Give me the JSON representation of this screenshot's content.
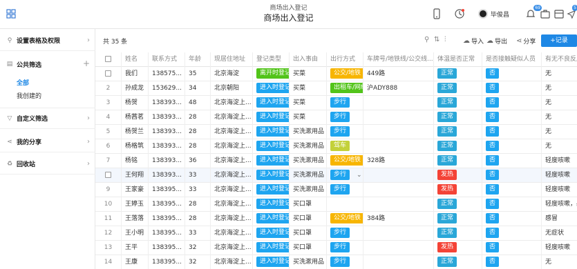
{
  "header": {
    "title_small": "商场出入登记",
    "title_big": "商场出入登记",
    "user_name": "毕俊昌",
    "badges": [
      "69",
      "5"
    ]
  },
  "sidebar": {
    "items": [
      {
        "label": "设置表格及权限",
        "icon": "settings-icon",
        "control": "›"
      },
      {
        "label": "公共筛选",
        "icon": "document-icon",
        "control": "+"
      },
      {
        "label": "自定义筛选",
        "icon": "filter-icon",
        "control": "›"
      },
      {
        "label": "我的分享",
        "icon": "share-icon",
        "control": "›"
      },
      {
        "label": "回收站",
        "icon": "recycle-icon",
        "control": "›"
      }
    ],
    "sub_items": [
      "全部",
      "我创建的"
    ]
  },
  "toolbar": {
    "count": "共 35 条",
    "import_label": "导入",
    "export_label": "导出",
    "share_label": "分享",
    "add_label": "+记录"
  },
  "table": {
    "headers": [
      "姓名",
      "联系方式",
      "年龄",
      "现居住地址",
      "登记类型",
      "出入事由",
      "出行方式",
      "车牌号/地铁线/公交线...",
      "体温是否正常",
      "是否接触疑似人员",
      "有无不良反应"
    ],
    "rows": [
      {
        "no": "",
        "name": "我们",
        "phone": "138575...",
        "age": "35",
        "addr": "北京海淀",
        "type": "离开时登记",
        "reason": "买菜",
        "travel": "公交/地铁",
        "plate": "449路",
        "temp": "正常",
        "contact": "否",
        "symptom": "无"
      },
      {
        "no": "2",
        "name": "孙成龙",
        "phone": "153629...",
        "age": "34",
        "addr": "北京朝阳",
        "type": "进入时登记",
        "reason": "买菜",
        "travel": "出租车/网约车",
        "plate": "沪ADY888",
        "temp": "正常",
        "contact": "否",
        "symptom": "无"
      },
      {
        "no": "3",
        "name": "杨贺",
        "phone": "138393...",
        "age": "48",
        "addr": "北京海淀上...",
        "type": "进入时登记",
        "reason": "买菜",
        "travel": "步行",
        "plate": "",
        "temp": "正常",
        "contact": "否",
        "symptom": "无"
      },
      {
        "no": "4",
        "name": "杨茜茗",
        "phone": "138393...",
        "age": "28",
        "addr": "北京海淀上...",
        "type": "进入时登记",
        "reason": "买菜",
        "travel": "步行",
        "plate": "",
        "temp": "正常",
        "contact": "否",
        "symptom": "无"
      },
      {
        "no": "5",
        "name": "杨贺兰",
        "phone": "138393...",
        "age": "28",
        "addr": "北京海淀上...",
        "type": "进入时登记",
        "reason": "买洗漱用品",
        "travel": "步行",
        "plate": "",
        "temp": "正常",
        "contact": "否",
        "symptom": "无"
      },
      {
        "no": "6",
        "name": "杨格筑",
        "phone": "138393...",
        "age": "28",
        "addr": "北京海淀上...",
        "type": "进入时登记",
        "reason": "买洗漱用品",
        "travel": "驾车",
        "plate": "",
        "temp": "正常",
        "contact": "否",
        "symptom": "无"
      },
      {
        "no": "7",
        "name": "杨铭",
        "phone": "138393...",
        "age": "36",
        "addr": "北京海淀上...",
        "type": "进入时登记",
        "reason": "买洗漱用品",
        "travel": "公交/地铁",
        "plate": "328路",
        "temp": "正常",
        "contact": "否",
        "symptom": "轻度咳嗽"
      },
      {
        "no": "",
        "name": "王何翔",
        "phone": "138393...",
        "age": "33",
        "addr": "北京海淀上...",
        "type": "进入时登记",
        "reason": "买洗漱用品",
        "travel": "步行",
        "plate": "",
        "temp": "发热",
        "contact": "否",
        "symptom": "轻度咳嗽"
      },
      {
        "no": "9",
        "name": "王家豪",
        "phone": "138395...",
        "age": "33",
        "addr": "北京海淀上...",
        "type": "进入时登记",
        "reason": "买洗漱用品",
        "travel": "步行",
        "plate": "",
        "temp": "发热",
        "contact": "否",
        "symptom": "轻度咳嗽"
      },
      {
        "no": "10",
        "name": "王婷玉",
        "phone": "138395...",
        "age": "28",
        "addr": "北京海淀上...",
        "type": "进入时登记",
        "reason": "买口罩",
        "travel": "",
        "plate": "",
        "temp": "正常",
        "contact": "否",
        "symptom": "轻度咳嗽，感"
      },
      {
        "no": "11",
        "name": "王落落",
        "phone": "138395...",
        "age": "28",
        "addr": "北京海淀上...",
        "type": "进入时登记",
        "reason": "买口罩",
        "travel": "公交/地铁",
        "plate": "384路",
        "temp": "正常",
        "contact": "否",
        "symptom": "感冒"
      },
      {
        "no": "12",
        "name": "王小明",
        "phone": "138395...",
        "age": "33",
        "addr": "北京海淀上...",
        "type": "进入时登记",
        "reason": "买口罩",
        "travel": "步行",
        "plate": "",
        "temp": "正常",
        "contact": "否",
        "symptom": "无症状"
      },
      {
        "no": "13",
        "name": "王平",
        "phone": "138395...",
        "age": "32",
        "addr": "北京海淀上...",
        "type": "进入时登记",
        "reason": "买口罩",
        "travel": "步行",
        "plate": "",
        "temp": "发热",
        "contact": "否",
        "symptom": "轻度咳嗽"
      },
      {
        "no": "14",
        "name": "王康",
        "phone": "138395...",
        "age": "32",
        "addr": "北京海淀上...",
        "type": "进入时登记",
        "reason": "买洗漱用品",
        "travel": "步行",
        "plate": "",
        "temp": "正常",
        "contact": "否",
        "symptom": "无"
      }
    ]
  },
  "colors": {
    "primary": "#1e88e5",
    "tag_blue": "#1ea5f0",
    "tag_green": "#52c41a",
    "tag_yellow": "#f7b500",
    "tag_red": "#f44336"
  }
}
